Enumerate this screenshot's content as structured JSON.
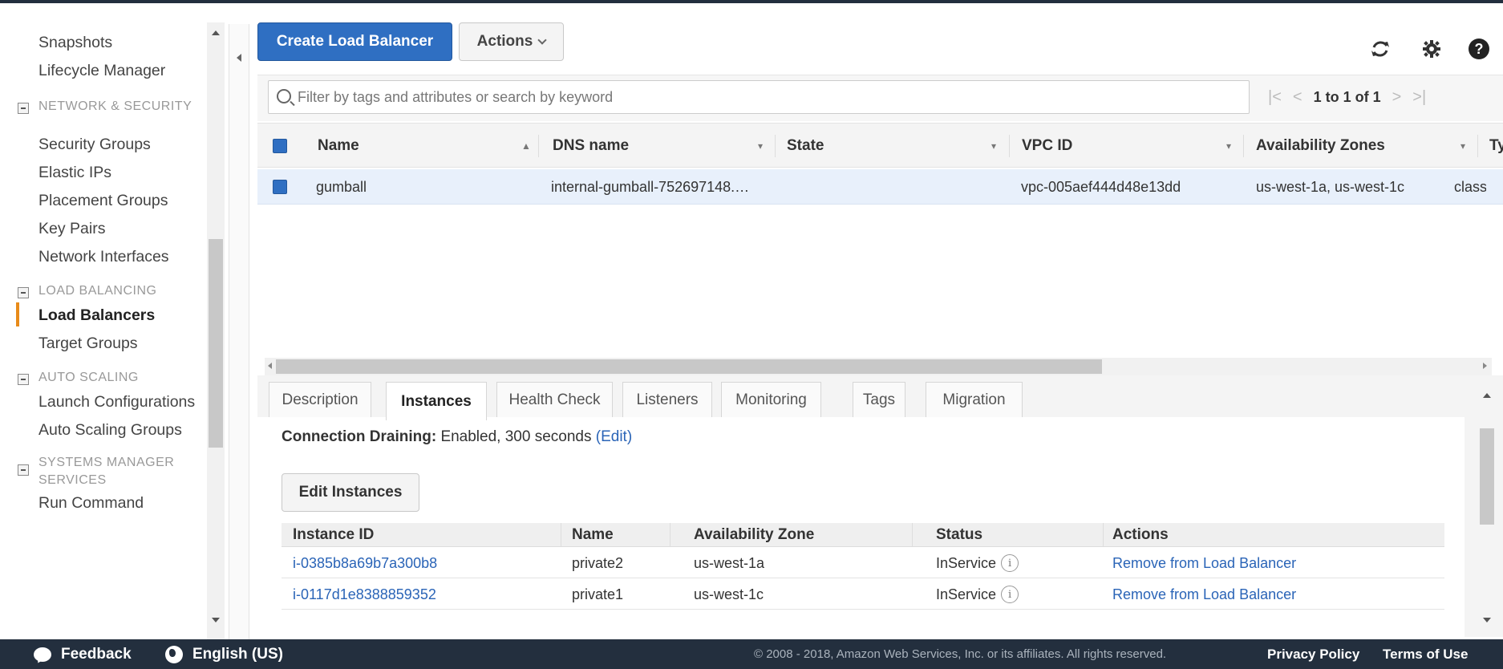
{
  "sidebar": {
    "items_top": [
      {
        "label": "Snapshots"
      },
      {
        "label": "Lifecycle Manager"
      }
    ],
    "sections": [
      {
        "title": "NETWORK & SECURITY",
        "items": [
          "Security Groups",
          "Elastic IPs",
          "Placement Groups",
          "Key Pairs",
          "Network Interfaces"
        ]
      },
      {
        "title": "LOAD BALANCING",
        "items": [
          "Load Balancers",
          "Target Groups"
        ]
      },
      {
        "title": "AUTO SCALING",
        "items": [
          "Launch Configurations",
          "Auto Scaling Groups"
        ]
      },
      {
        "title": "SYSTEMS MANAGER SERVICES",
        "items": [
          "Run Command"
        ]
      }
    ],
    "active_item": "Load Balancers",
    "active_color": "#e88b1a"
  },
  "toolbar": {
    "create_label": "Create Load Balancer",
    "actions_label": "Actions",
    "refresh_icon": "refresh-icon",
    "settings_icon": "gear-icon",
    "help_icon": "help-icon",
    "help_glyph": "?"
  },
  "search": {
    "placeholder": "Filter by tags and attributes or search by keyword",
    "value": ""
  },
  "pager": {
    "first": "|<",
    "prev": "<",
    "count": "1 to 1 of 1",
    "next": ">",
    "last": ">|"
  },
  "grid": {
    "columns": [
      "Name",
      "DNS name",
      "State",
      "VPC ID",
      "Availability Zones",
      "Type"
    ],
    "rows": [
      {
        "selected": true,
        "name": "gumball",
        "dns": "internal-gumball-752697148.…",
        "state": "",
        "vpc": "vpc-005aef444d48e13dd",
        "zones": "us-west-1a, us-west-1c",
        "type": "classic"
      }
    ]
  },
  "tabs": [
    "Description",
    "Instances",
    "Health Check",
    "Listeners",
    "Monitoring",
    "Tags",
    "Migration"
  ],
  "active_tab": "Instances",
  "instances": {
    "draining_label": "Connection Draining:",
    "draining_value": "Enabled, 300 seconds",
    "draining_edit": "(Edit)",
    "edit_button": "Edit Instances",
    "columns": [
      "Instance ID",
      "Name",
      "Availability Zone",
      "Status",
      "Actions"
    ],
    "rows": [
      {
        "id": "i-0385b8a69b7a300b8",
        "name": "private2",
        "zone": "us-west-1a",
        "status": "InService",
        "action": "Remove from Load Balancer"
      },
      {
        "id": "i-0117d1e8388859352",
        "name": "private1",
        "zone": "us-west-1c",
        "status": "InService",
        "action": "Remove from Load Balancer"
      }
    ]
  },
  "footer": {
    "feedback": "Feedback",
    "language": "English (US)",
    "copyright": "© 2008 - 2018, Amazon Web Services, Inc. or its affiliates. All rights reserved.",
    "privacy": "Privacy Policy",
    "terms": "Terms of Use"
  },
  "colors": {
    "primary": "#2f6fc2",
    "link": "#2a64b7",
    "footer_bg": "#232f3e",
    "selected_row": "#e8f0fb"
  }
}
